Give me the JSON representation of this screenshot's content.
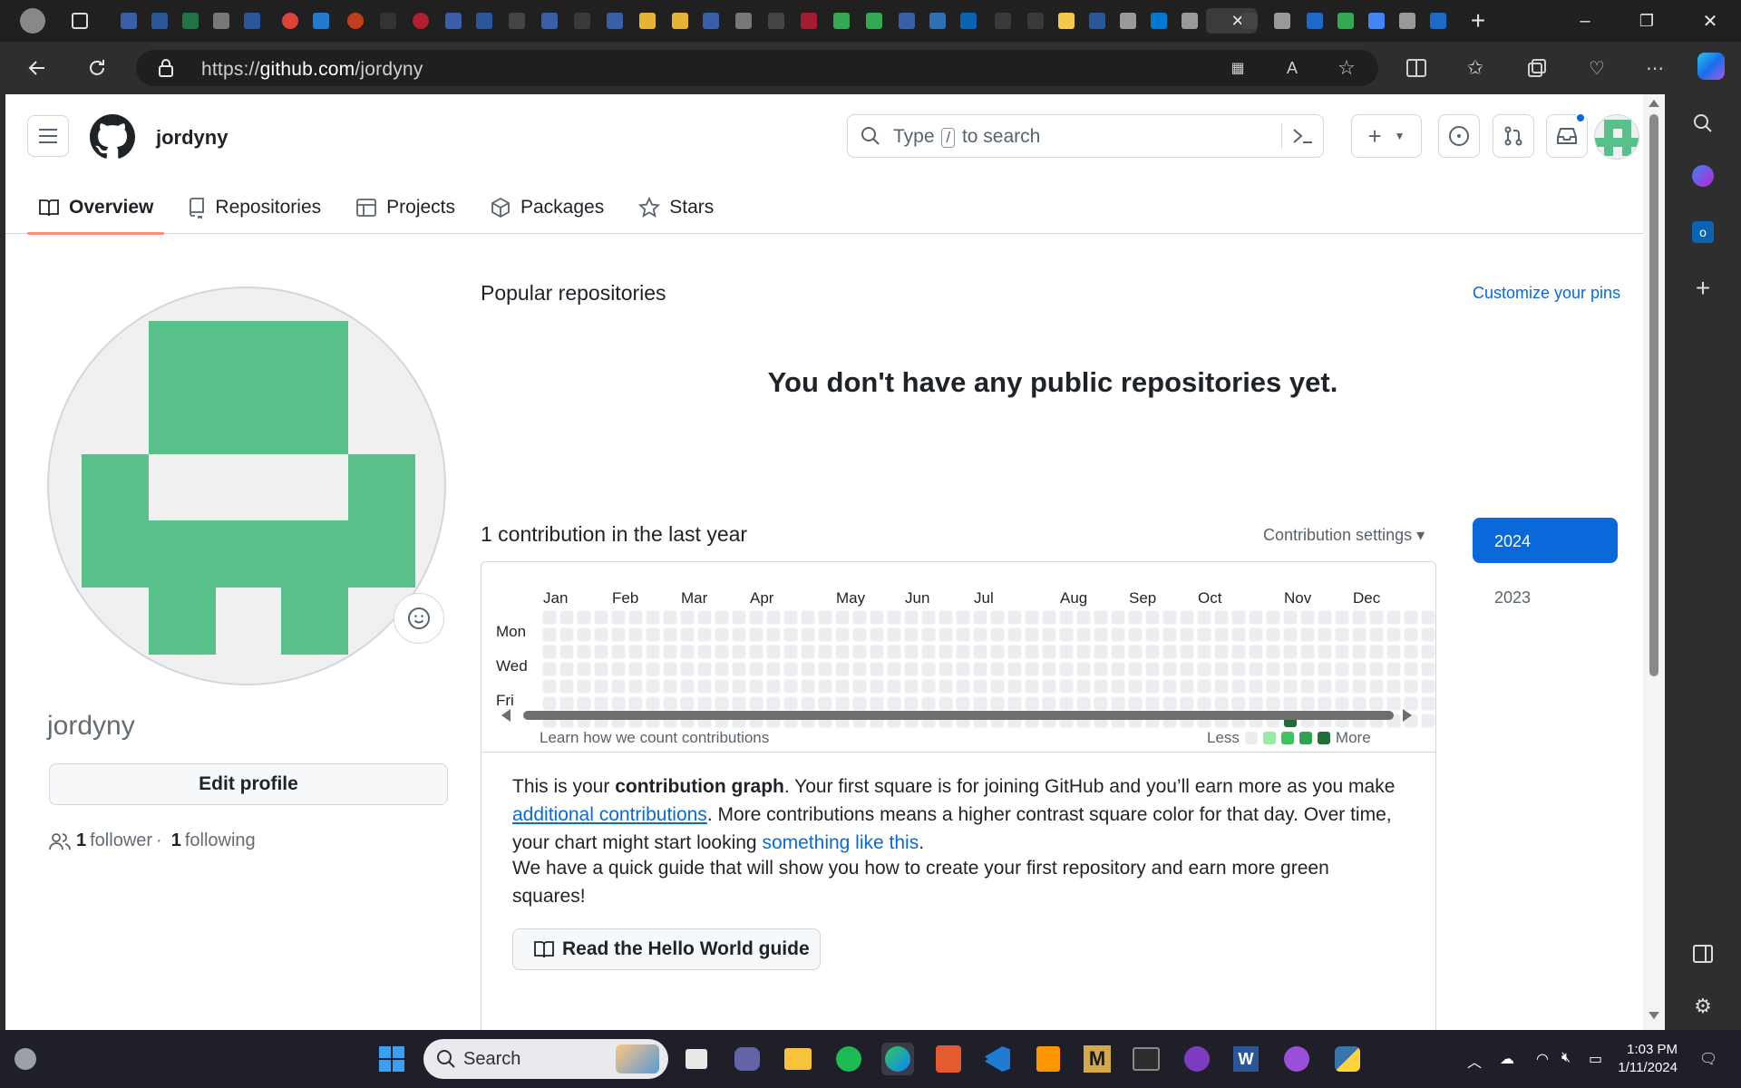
{
  "browser": {
    "url_prefix": "https://",
    "url_domain": "github.com",
    "url_path": "/jordyny"
  },
  "header": {
    "username": "jordyny",
    "search_prefix": "Type",
    "search_key": "/",
    "search_suffix": "to search"
  },
  "tabs": [
    {
      "label": "Overview",
      "icon": "book-icon",
      "selected": true
    },
    {
      "label": "Repositories",
      "icon": "repo-icon"
    },
    {
      "label": "Projects",
      "icon": "table-icon"
    },
    {
      "label": "Packages",
      "icon": "package-icon"
    },
    {
      "label": "Stars",
      "icon": "star-icon"
    }
  ],
  "profile": {
    "name": "jordyny",
    "edit_label": "Edit profile",
    "followers_count": "1",
    "followers_label": "follower",
    "separator": "·",
    "following_count": "1",
    "following_label": "following",
    "avatar_color": "#58c08b"
  },
  "popular": {
    "title": "Popular repositories",
    "customize": "Customize your pins",
    "empty": "You don't have any public repositories yet."
  },
  "contributions": {
    "title": "1 contribution in the last year",
    "settings": "Contribution settings ▾",
    "years": [
      "2024",
      "2023"
    ],
    "selected_year": "2024",
    "months": [
      "Jan",
      "Feb",
      "Mar",
      "Apr",
      "May",
      "Jun",
      "Jul",
      "Aug",
      "Sep",
      "Oct",
      "Nov",
      "Dec"
    ],
    "days": [
      "Mon",
      "Wed",
      "Fri"
    ],
    "learn": "Learn how we count contributions",
    "legend_less": "Less",
    "legend_more": "More",
    "legend_colors": [
      "#ebedf0",
      "#9be9a8",
      "#40c463",
      "#30a14e",
      "#216e39"
    ],
    "active_week": 43,
    "active_day": 6,
    "active_color": "#216e39"
  },
  "explain": {
    "p1_a": "This is your ",
    "p1_b": "contribution graph",
    "p1_c": ". Your first square is for joining GitHub and you’ll earn more as you make ",
    "p1_link1": "additional contributions",
    "p1_d": ". More contributions means a higher contrast square color for that day. Over time, your chart might start looking ",
    "p1_link2": "something like this",
    "p1_e": ".",
    "p2": "We have a quick guide that will show you how to create your first repository and earn more green squares!",
    "hello_btn": "Read the Hello World guide"
  },
  "taskbar": {
    "search_label": "Search",
    "time": "1:03 PM",
    "date": "1/11/2024"
  }
}
